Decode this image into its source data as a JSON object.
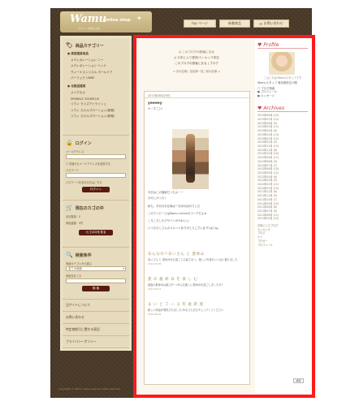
{
  "header": {
    "logo_text": "Wamu",
    "logo_sub": "online shop",
    "logo_tag": "カワイイを贈るお店",
    "nav": [
      "top ページ",
      "新着商品",
      "お問い合わせ"
    ]
  },
  "sidebar": {
    "category_title": "商品カテゴリー",
    "groups": [
      {
        "label": "● 美容雑貨商品",
        "items": [
          "メディボレーション ニー",
          "メディボレーション ヘッド",
          "ヴィーナスシリスル ホールドア",
          "パーフェクトBWE"
        ]
      },
      {
        "label": "● 化粧品雑貨",
        "items": [
          "メイクセル",
          "SPARKLE 2000PLUS",
          "リウィ ライズアイラッシュ",
          "リウィ スカルプローション(新発)",
          "リウィ スカルプローション(新発)"
        ]
      }
    ],
    "login_title": "ログイン",
    "mail_label": "メールアドレス",
    "remember_label": "次回からメールアドレスを記憶する",
    "password_label": "パスワード",
    "forgot_label": "パスワードを忘れた方はこちら",
    "login_button": "ログイン",
    "cart_title": "現在のカゴの中",
    "cart_count": "合計数量：0",
    "cart_total": "商品金額：0円",
    "cart_button": "カゴの中を見る",
    "search_title": "検索条件",
    "search_cat_label": "商品カテゴリから選ぶ",
    "search_select": "全ての商品",
    "search_name_label": "商品名を入力",
    "search_button": "検 索",
    "links": [
      "当サイトについて",
      "お問い合わせ",
      "特定商取引に関する表記",
      "プライバシーポリシー"
    ]
  },
  "main": {
    "notice1": "このブログの読者になる",
    "notice2": "お気に入り登録/ランキング参加",
    "notice3": "このブログの読者になる | ブログ",
    "pagenav": "< 次の記事 | 全記事一覧 | 前の記事 >",
    "date": "2013年08月29日",
    "post_title": "yeeeey",
    "post_greeting": "キーすごい!",
    "post_lines": [
      "今日はこの撮影だったよーー",
      "たのしかった♪",
      "私も、今日のお仕事は一日ほのぼのでした",
      "このワンピースはWamu onlineのコーデだよ★",
      "ころころしたデザインがかわいい",
      "いつもたくさんのコメントありがとうございます!(≧▽≦)"
    ],
    "more": [
      {
        "title": "あんなの!!あいさん と 夏休み",
        "text": "あいさん と 夏休みをお過ごしの皆さまへ。楽しい写真をいっぱい撮りました",
        "date": "2013-08-28"
      },
      {
        "title": "夏 の 最 終 日 を 楽 し む",
        "text": "最後の夏休みは遊ぶぞー!みんな楽しい夏休みを過ごしましたか?",
        "date": "2013-08-27"
      },
      {
        "title": "ま い ど フ ー る 年 後 新 発",
        "text": "新しい商品が発売されました!みなさんぜひチェックしてください",
        "date": "2013-08-26"
      }
    ]
  },
  "right": {
    "profile_title": "Profile",
    "profile_name": "こんにちは!Wamuスタッフです",
    "profile_info": "Wamuスタッフ 東京都在住 B型",
    "profile_links": [
      "ブログ読者",
      "プロフィール",
      "メッセージ"
    ],
    "archives_title": "Archives",
    "archive_items": [
      "2013年08月 (10)",
      "2013年07月 (12)",
      "2013年06月 (9)",
      "2013年05月 (11)",
      "2013年04月 (8)",
      "2013年03月 (13)",
      "2013年02月 (10)",
      "2013年01月 (9)",
      "2012年12月 (12)",
      "2012年11月 (8)",
      "2012年10月 (10)",
      "2012年09月 (11)",
      "2012年08月 (9)",
      "2012年07月 (7)",
      "2012年06月 (10)",
      "2012年05月 (12)",
      "2012年04月 (8)",
      "2012年03月 (9)",
      "2012年02月 (11)",
      "2012年01月 (10)",
      "2011年12月 (8)",
      "2011年11月 (9)",
      "2011年10月 (7)",
      "2011年09月 (10)",
      "2011年08月 (8)",
      "2011年07月 (9)",
      "2011年06月 (11)",
      "2011年05月 (10)"
    ],
    "bottom_items": [
      "お気に入りブログ",
      "ランキング",
      "ブログ",
      "ルイ",
      "ブロガー",
      "プロフィール"
    ],
    "small_btn": "検索"
  },
  "footer": "Copyright © Wamu online shop All rights reserved."
}
